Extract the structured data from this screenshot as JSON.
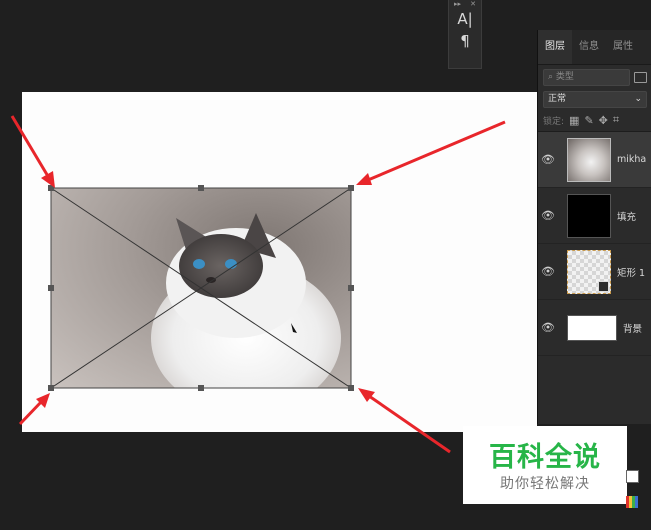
{
  "char_panel": {
    "collapse": "▸▸",
    "close": "✕",
    "char_tool": "A|",
    "para_tool": "¶"
  },
  "layers_panel": {
    "tabs": [
      {
        "label": "图层",
        "active": true
      },
      {
        "label": "信息",
        "active": false
      },
      {
        "label": "属性",
        "active": false
      }
    ],
    "filter_placeholder": "类型",
    "blend_mode": "正常",
    "lock_label": "锁定:",
    "layers": [
      {
        "name": "mikha",
        "thumb": "cat",
        "selected": true
      },
      {
        "name": "填充",
        "thumb": "black",
        "selected": false
      },
      {
        "name": "矩形 1",
        "thumb": "checker",
        "selected": false
      },
      {
        "name": "背景",
        "thumb": "white",
        "selected": false
      }
    ]
  },
  "watermark": {
    "title": "百科全说",
    "subtitle": "助你轻松解决"
  },
  "colors": {
    "arrow": "#e8262b",
    "watermark_green": "#27b548",
    "panel_bg": "#2b2b2b",
    "workspace_bg": "#1f1f1f"
  }
}
